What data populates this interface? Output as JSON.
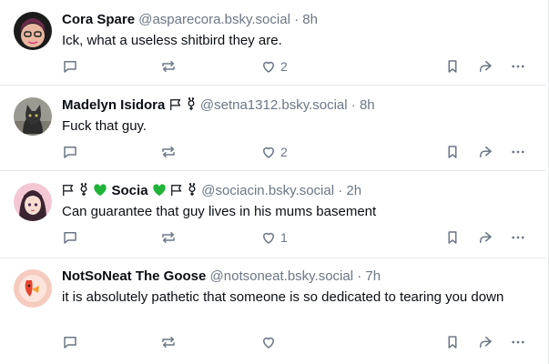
{
  "posts": [
    {
      "name": "Cora Spare",
      "handle": "@asparecora.bsky.social",
      "time": "8h",
      "text": "Ick, what a useless shitbird they are.",
      "like_count": "2",
      "colors": {
        "avatar_bg": "#1b1b1b",
        "avatar_accent": "#d63c7a"
      }
    },
    {
      "name": "Madelyn Isidora",
      "name_suffix_icons": [
        "flag-icon",
        "transgender-symbol-icon"
      ],
      "handle": "@setna1312.bsky.social",
      "time": "8h",
      "text": "Fuck that guy.",
      "like_count": "2",
      "colors": {
        "avatar_bg": "#8a8a82"
      }
    },
    {
      "name": "Socia",
      "name_prefix_icons": [
        "flag-icon",
        "transgender-symbol-icon",
        "green-heart-icon"
      ],
      "name_suffix_icons": [
        "green-heart-icon",
        "flag-icon",
        "transgender-symbol-icon"
      ],
      "handle": "@sociacin.bsky.social",
      "time": "2h",
      "text": "Can guarantee that guy lives in his mums basement",
      "like_count": "1",
      "colors": {
        "avatar_bg": "#f3c7d4",
        "heart": "#21b33a"
      }
    },
    {
      "name": "NotSoNeat The Goose",
      "handle": "@notsoneat.bsky.social",
      "time": "7h",
      "text": "it is absolutely pathetic that someone is so dedicated to tearing you down",
      "like_count": "",
      "colors": {
        "avatar_bg": "#f6cbbf",
        "avatar_accent": "#e8442e"
      }
    }
  ],
  "separator": "·",
  "colors": {
    "muted": "#6b7685",
    "text": "#0b0f14",
    "border": "#e3e7ec"
  }
}
